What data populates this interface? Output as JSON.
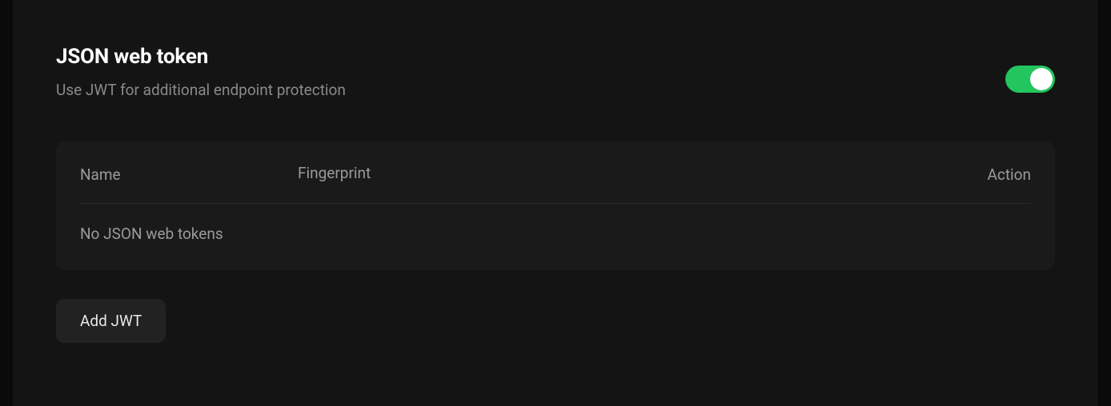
{
  "section": {
    "title": "JSON web token",
    "subtitle": "Use JWT for additional endpoint protection",
    "toggle_enabled": true
  },
  "table": {
    "headers": {
      "name": "Name",
      "fingerprint": "Fingerprint",
      "action": "Action"
    },
    "empty_message": "No JSON web tokens"
  },
  "buttons": {
    "add_jwt": "Add JWT"
  },
  "colors": {
    "toggle_on": "#22c55e",
    "background": "#0a0a0a",
    "panel": "#141414",
    "card": "#1a1a1a"
  }
}
